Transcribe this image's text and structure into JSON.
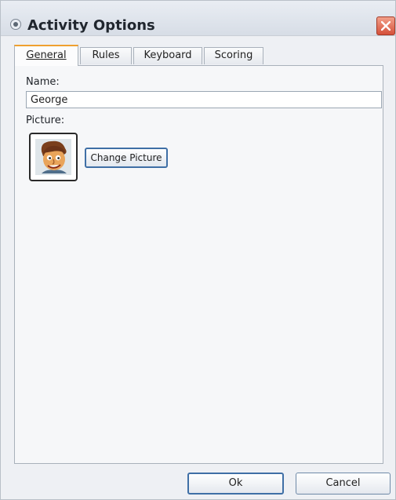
{
  "window": {
    "title": "Activity Options"
  },
  "tabs": [
    {
      "label": "General",
      "active": true
    },
    {
      "label": "Rules",
      "active": false
    },
    {
      "label": "Keyboard",
      "active": false
    },
    {
      "label": "Scoring",
      "active": false
    }
  ],
  "general": {
    "name_label": "Name:",
    "name_value": "George",
    "picture_label": "Picture:",
    "change_picture_label": "Change Picture"
  },
  "footer": {
    "ok_label": "Ok",
    "cancel_label": "Cancel"
  },
  "icons": {
    "title": "app-icon",
    "close": "close-icon",
    "avatar": "cartoon-face-avatar"
  },
  "colors": {
    "active_tab_accent": "#f0a030",
    "close_button": "#d5503a",
    "focus_border": "#3f6fa6"
  }
}
